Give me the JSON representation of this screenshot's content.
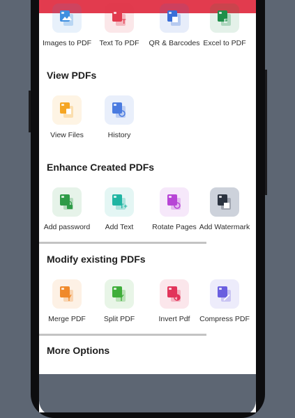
{
  "colors": {
    "accent": "#e23b4e",
    "background": "#5d6673"
  },
  "top_row": [
    {
      "label": "Images to PDF",
      "icon": "image-icon",
      "color": "#3f8fe0"
    },
    {
      "label": "Text To PDF",
      "icon": "text-icon",
      "color": "#e23b4e"
    },
    {
      "label": "QR & Barcodes",
      "icon": "qr-icon",
      "color": "#3a6fd8"
    },
    {
      "label": "Excel to PDF",
      "icon": "excel-icon",
      "color": "#1f8f4a"
    }
  ],
  "sections": {
    "view": {
      "title": "View PDFs",
      "items": [
        {
          "label": "View Files",
          "icon": "folder-icon",
          "color": "#f5a623"
        },
        {
          "label": "History",
          "icon": "history-icon",
          "color": "#4a7be0"
        }
      ]
    },
    "enhance": {
      "title": "Enhance Created PDFs",
      "items": [
        {
          "label": "Add password",
          "icon": "lock-icon",
          "color": "#2e9b47"
        },
        {
          "label": "Add Text",
          "icon": "add-text-icon",
          "color": "#1fb5a3"
        },
        {
          "label": "Rotate Pages",
          "icon": "rotate-icon",
          "color": "#b845d6"
        },
        {
          "label": "Add Watermark",
          "icon": "watermark-icon",
          "color": "#2c3440"
        }
      ]
    },
    "modify": {
      "title": "Modify existing PDFs",
      "items": [
        {
          "label": "Merge PDF",
          "icon": "merge-icon",
          "color": "#f08a2c"
        },
        {
          "label": "Split PDF",
          "icon": "split-icon",
          "color": "#3fae3a"
        },
        {
          "label": "Invert Pdf",
          "icon": "invert-icon",
          "color": "#e2345a"
        },
        {
          "label": "Compress PDF",
          "icon": "compress-icon",
          "color": "#6a5fe0"
        }
      ]
    },
    "more": {
      "title": "More Options"
    }
  }
}
